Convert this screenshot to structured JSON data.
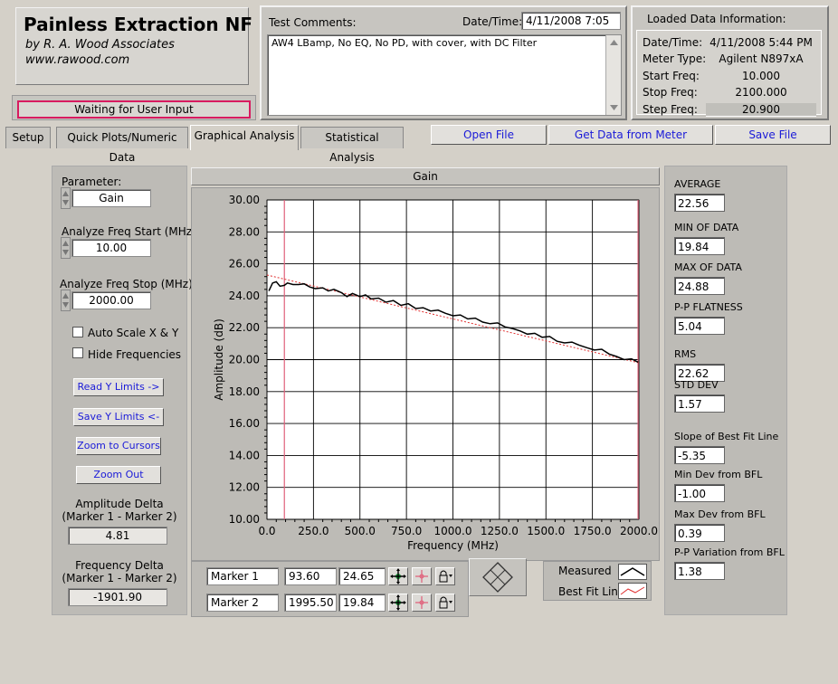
{
  "header": {
    "app_title": "Painless Extraction NF",
    "author": "by R. A. Wood Associates",
    "website": "www.rawood.com",
    "status": "Waiting for User Input"
  },
  "comments": {
    "label": "Test Comments:",
    "datetime_label": "Date/Time:",
    "datetime_value": "4/11/2008  7:05",
    "text": "AW4 LBamp, No EQ, No PD, with cover, with DC Filter"
  },
  "loaded": {
    "title": "Loaded Data Information:",
    "rows": [
      {
        "label": "Date/Time:",
        "value": "4/11/2008  5:44 PM"
      },
      {
        "label": "Meter Type:",
        "value": "Agilent N897xA"
      },
      {
        "label": "Start Freq:",
        "value": "10.000"
      },
      {
        "label": "Stop Freq:",
        "value": "2100.000"
      },
      {
        "label": "Step Freq:",
        "value": "20.900"
      }
    ]
  },
  "tabs": [
    "Setup",
    "Quick Plots/Numeric Data",
    "Graphical Analysis",
    "Statistical Analysis"
  ],
  "active_tab": "Graphical Analysis",
  "toolbar": {
    "open": "Open File",
    "meter": "Get Data from Meter",
    "save": "Save File"
  },
  "left": {
    "parameter_label": "Parameter:",
    "parameter_value": "Gain",
    "start_label": "Analyze Freq Start (MHz)",
    "start_value": "10.00",
    "stop_label": "Analyze Freq Stop (MHz)",
    "stop_value": "2000.00",
    "autoscale_label": "Auto Scale X & Y",
    "hidefreq_label": "Hide Frequencies",
    "read_y": "Read Y Limits ->",
    "save_y": "Save Y Limits <-",
    "zoom_cursors": "Zoom to Cursors",
    "zoom_out": "Zoom Out",
    "amp_delta_label": "Amplitude Delta",
    "amp_delta_sub": "(Marker 1 - Marker 2)",
    "amp_delta_value": "4.81",
    "freq_delta_label": "Frequency Delta",
    "freq_delta_sub": "(Marker 1 - Marker 2)",
    "freq_delta_value": "-1901.90"
  },
  "markers": [
    {
      "name": "Marker 1",
      "freq": "93.60",
      "amp": "24.65"
    },
    {
      "name": "Marker 2",
      "freq": "1995.50",
      "amp": "19.84"
    }
  ],
  "legend": {
    "measured": "Measured",
    "bfl": "Best Fit Line"
  },
  "stats": [
    {
      "label": "AVERAGE",
      "value": "22.56"
    },
    {
      "label": "MIN OF DATA",
      "value": "19.84"
    },
    {
      "label": "MAX OF DATA",
      "value": "24.88"
    },
    {
      "label": "P-P FLATNESS",
      "value": "5.04"
    },
    {
      "label": "RMS",
      "value": "22.62"
    },
    {
      "label": "STD DEV",
      "value": "1.57"
    },
    {
      "label": "Slope of Best Fit Line",
      "value": "-5.35"
    },
    {
      "label": "Min Dev from BFL",
      "value": "-1.00"
    },
    {
      "label": "Max Dev from BFL",
      "value": "0.39"
    },
    {
      "label": "P-P Variation from BFL",
      "value": "1.38"
    }
  ],
  "colors": {
    "measured": "#000000",
    "bfl": "#e03030",
    "marker": "#e0607a",
    "status_border": "#d81b60"
  },
  "chart_data": {
    "type": "line",
    "title": "Gain",
    "xlabel": "Frequency (MHz)",
    "ylabel": "Amplitude (dB)",
    "xlim": [
      0,
      2000
    ],
    "ylim": [
      10,
      30
    ],
    "xticks": [
      "0.0",
      "250.0",
      "500.0",
      "750.0",
      "1000.0",
      "1250.0",
      "1500.0",
      "1750.0",
      "2000.0"
    ],
    "yticks": [
      "10.00",
      "12.00",
      "14.00",
      "16.00",
      "18.00",
      "20.00",
      "22.00",
      "24.00",
      "26.00",
      "28.00",
      "30.00"
    ],
    "grid": true,
    "markers_x": [
      93.6,
      1995.5
    ],
    "series": [
      {
        "name": "Measured",
        "x": [
          10,
          30,
          50,
          70,
          93.6,
          110,
          140,
          170,
          200,
          230,
          260,
          300,
          330,
          360,
          400,
          430,
          460,
          500,
          530,
          560,
          600,
          640,
          680,
          720,
          760,
          800,
          840,
          880,
          920,
          960,
          1000,
          1040,
          1080,
          1120,
          1160,
          1200,
          1240,
          1280,
          1320,
          1360,
          1400,
          1440,
          1480,
          1520,
          1560,
          1600,
          1640,
          1680,
          1720,
          1760,
          1800,
          1840,
          1880,
          1920,
          1960,
          1995.5
        ],
        "values": [
          24.3,
          24.8,
          24.88,
          24.6,
          24.65,
          24.8,
          24.7,
          24.7,
          24.75,
          24.55,
          24.45,
          24.5,
          24.3,
          24.4,
          24.2,
          23.95,
          24.15,
          23.95,
          24.05,
          23.8,
          23.85,
          23.6,
          23.7,
          23.4,
          23.5,
          23.2,
          23.25,
          23.05,
          23.1,
          22.9,
          22.75,
          22.8,
          22.55,
          22.6,
          22.35,
          22.25,
          22.3,
          22.05,
          21.95,
          21.8,
          21.6,
          21.65,
          21.4,
          21.45,
          21.15,
          21.05,
          21.1,
          20.9,
          20.75,
          20.6,
          20.65,
          20.35,
          20.2,
          20.0,
          20.05,
          19.84
        ]
      },
      {
        "name": "Best Fit Line",
        "x": [
          0,
          2000
        ],
        "values": [
          25.3,
          19.8
        ]
      }
    ]
  }
}
